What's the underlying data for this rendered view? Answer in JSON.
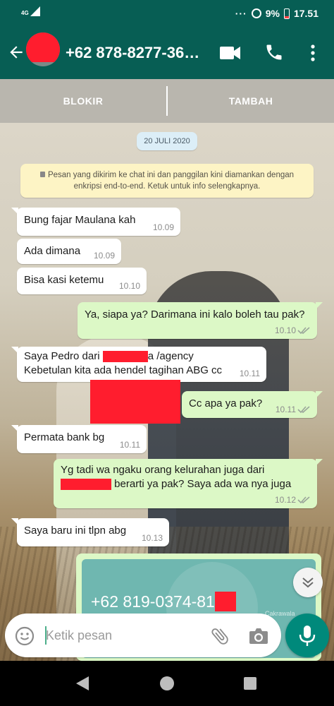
{
  "status_bar": {
    "network": "4G",
    "battery": "9%",
    "time": "17.51",
    "overflow": "···"
  },
  "header": {
    "contact_name": "+62 878-8277-36…"
  },
  "action_bar": {
    "block_label": "BLOKIR",
    "add_label": "TAMBAH"
  },
  "chat": {
    "date_chip": "20 JULI 2020",
    "encryption_note": "Pesan yang dikirim ke chat ini dan panggilan kini diamankan dengan enkripsi end-to-end. Ketuk untuk info selengkapnya.",
    "messages": [
      {
        "dir": "in",
        "text": "Bung fajar Maulana kah",
        "time": "10.09"
      },
      {
        "dir": "in",
        "text": "Ada dimana",
        "time": "10.09"
      },
      {
        "dir": "in",
        "text": "Bisa kasi ketemu",
        "time": "10.10"
      },
      {
        "dir": "out",
        "text": "Ya, siapa ya? Darimana ini kalo boleh tau pak?",
        "time": "10.10"
      },
      {
        "dir": "in",
        "text_a": "Saya Pedro dari",
        "text_b": "a /agency",
        "text_c": "Kebetulan kita ada hendel tagihan ABG cc",
        "time": "10.11"
      },
      {
        "dir": "out",
        "text": "Cc apa ya pak?",
        "time": "10.11"
      },
      {
        "dir": "in",
        "text": "Permata bank bg",
        "time": "10.11"
      },
      {
        "dir": "out",
        "text_a": "Yg tadi wa ngaku orang kelurahan juga dari",
        "text_b": "berarti ya pak? Saya ada wa nya juga",
        "time": "10.12"
      },
      {
        "dir": "in",
        "text": "Saya baru ini tlpn abg",
        "time": "10.13"
      }
    ],
    "contact_card": {
      "number": "+62 819-0374-81",
      "caption": "Cakrawala"
    }
  },
  "composer": {
    "placeholder": "Ketik pesan"
  },
  "colors": {
    "header": "#075e54",
    "outgoing_bubble": "#dcf8c6",
    "incoming_bubble": "#ffffff",
    "mic_button": "#00897b",
    "redaction": "#ff1d2e"
  },
  "icons": {
    "back": "back-arrow-icon",
    "video": "video-call-icon",
    "call": "phone-icon",
    "menu": "more-vert-icon",
    "emoji": "emoji-icon",
    "attach": "paperclip-icon",
    "camera": "camera-icon",
    "mic": "mic-icon",
    "scroll": "double-chevron-down-icon"
  }
}
